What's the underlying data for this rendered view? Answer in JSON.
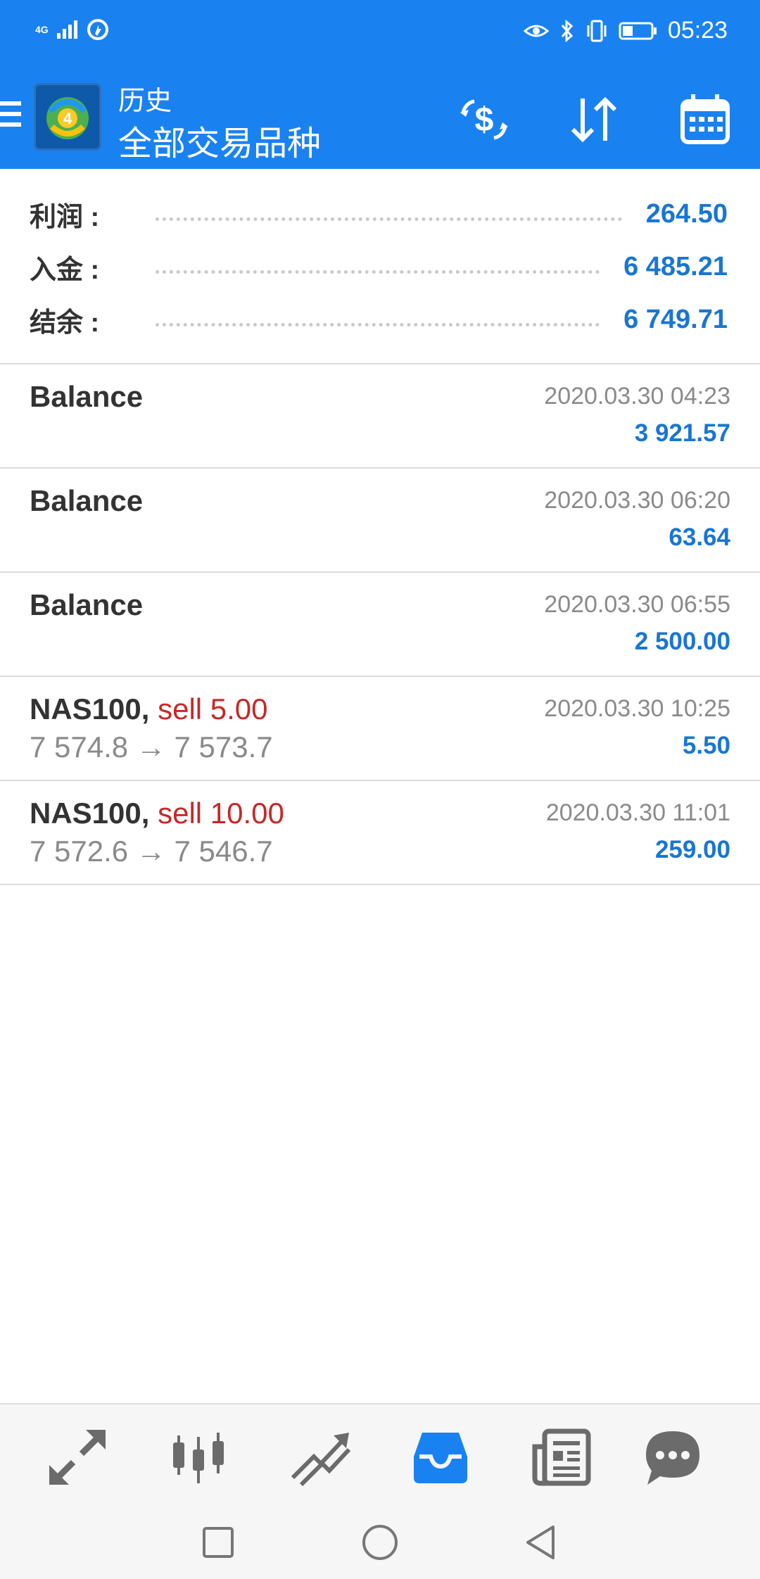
{
  "status_bar": {
    "network": "4G",
    "time": "05:23",
    "icons": [
      "signal-icon",
      "data-saver-icon",
      "eye-comfort-icon",
      "bluetooth-icon",
      "vibrate-icon",
      "battery-icon"
    ]
  },
  "app_bar": {
    "title": "历史",
    "subtitle": "全部交易品种",
    "actions": [
      "currency-exchange-icon",
      "sort-icon",
      "calendar-icon"
    ]
  },
  "summary": {
    "profit_label": "利润 :",
    "profit_value": "264.50",
    "deposit_label": "入金 :",
    "deposit_value": "6 485.21",
    "balance_label": "结余 :",
    "balance_value": "6 749.71"
  },
  "history": [
    {
      "title": "Balance",
      "date": "2020.03.30 04:23",
      "amount": "3 921.57"
    },
    {
      "title": "Balance",
      "date": "2020.03.30 06:20",
      "amount": "63.64"
    },
    {
      "title": "Balance",
      "date": "2020.03.30 06:55",
      "amount": "2 500.00"
    },
    {
      "title": "NAS100,",
      "action": "sell 5.00",
      "prices": "7 574.8 → 7 573.7",
      "date": "2020.03.30 10:25",
      "amount": "5.50"
    },
    {
      "title": "NAS100,",
      "action": "sell 10.00",
      "prices": "7 572.6 → 7 546.7",
      "date": "2020.03.30 11:01",
      "amount": "259.00"
    }
  ],
  "bottom_nav": [
    "quotes-icon",
    "chart-icon",
    "trade-icon",
    "history-icon",
    "news-icon",
    "chat-icon"
  ],
  "system_nav": [
    "recent-apps-icon",
    "home-icon",
    "back-icon"
  ],
  "colors": {
    "primary": "#1a82f0",
    "value_blue": "#1976d2",
    "sell_red": "#c62828",
    "muted": "#8a8a8a"
  }
}
